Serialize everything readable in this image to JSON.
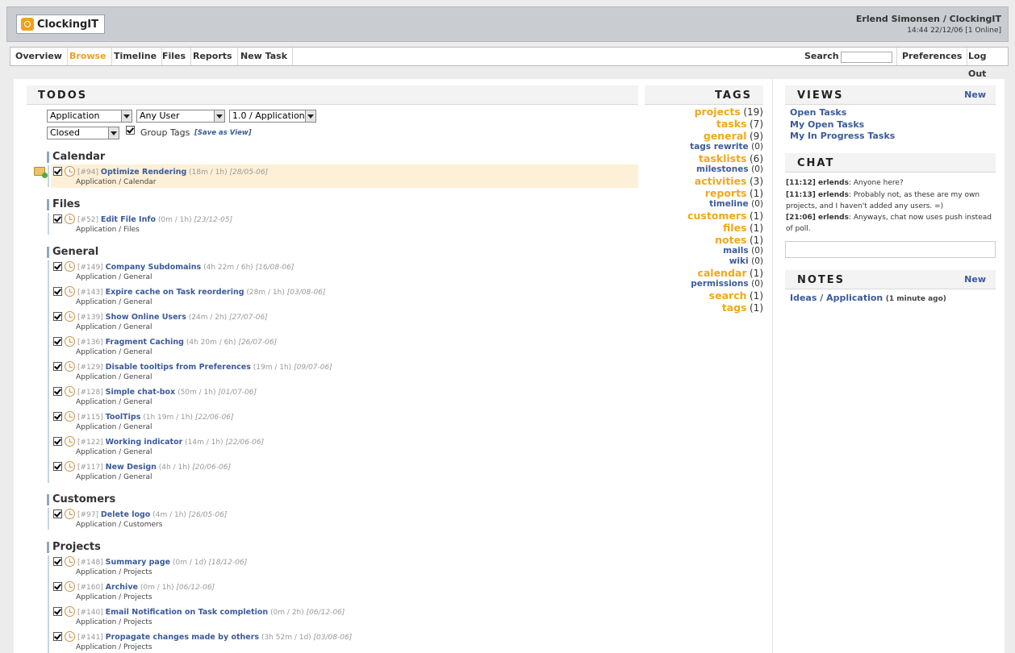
{
  "app": {
    "logo_text": "ClockingIT",
    "user_name": "Erlend Simonsen / ClockingIT",
    "status_line": "14:44 22/12/06 [1 Online]"
  },
  "nav": {
    "items": [
      "Overview",
      "Browse",
      "Timeline",
      "Files",
      "Reports",
      "New Task"
    ],
    "active": "Browse",
    "search_label": "Search",
    "search_value": "",
    "preferences": "Preferences",
    "logout": "Log Out"
  },
  "todos": {
    "title": "TODOS",
    "filters": {
      "project": "Application",
      "user": "Any User",
      "milestone": "1.0 / Application",
      "status": "Closed",
      "group_tags_label": "Group Tags",
      "save_view": "[Save as View]"
    },
    "groups": [
      {
        "name": "Calendar",
        "tasks": [
          {
            "id": "[#94]",
            "name": "Optimize Rendering",
            "time": "(18m / 1h)",
            "date": "[28/05-06]",
            "path": "Application / Calendar",
            "highlight": true
          }
        ]
      },
      {
        "name": "Files",
        "tasks": [
          {
            "id": "[#52]",
            "name": "Edit File Info",
            "time": "(0m / 1h)",
            "date": "[23/12-05]",
            "path": "Application / Files"
          }
        ]
      },
      {
        "name": "General",
        "tasks": [
          {
            "id": "[#149]",
            "name": "Company Subdomains",
            "time": "(4h 22m / 6h)",
            "date": "[16/08-06]",
            "path": "Application / General"
          },
          {
            "id": "[#143]",
            "name": "Expire cache on Task reordering",
            "time": "(28m / 1h)",
            "date": "[03/08-06]",
            "path": "Application / General"
          },
          {
            "id": "[#139]",
            "name": "Show Online Users",
            "time": "(24m / 2h)",
            "date": "[27/07-06]",
            "path": "Application / General"
          },
          {
            "id": "[#136]",
            "name": "Fragment Caching",
            "time": "(4h 20m / 6h)",
            "date": "[26/07-06]",
            "path": "Application / General"
          },
          {
            "id": "[#129]",
            "name": "Disable tooltips from Preferences",
            "time": "(19m / 1h)",
            "date": "[09/07-06]",
            "path": "Application / General"
          },
          {
            "id": "[#128]",
            "name": "Simple chat-box",
            "time": "(50m / 1h)",
            "date": "[01/07-06]",
            "path": "Application / General"
          },
          {
            "id": "[#115]",
            "name": "ToolTips",
            "time": "(1h 19m / 1h)",
            "date": "[22/06-06]",
            "path": "Application / General"
          },
          {
            "id": "[#122]",
            "name": "Working indicator",
            "time": "(14m / 1h)",
            "date": "[22/06-06]",
            "path": "Application / General"
          },
          {
            "id": "[#117]",
            "name": "New Design",
            "time": "(4h / 1h)",
            "date": "[20/06-06]",
            "path": "Application / General"
          }
        ]
      },
      {
        "name": "Customers",
        "tasks": [
          {
            "id": "[#97]",
            "name": "Delete logo",
            "time": "(4m / 1h)",
            "date": "[26/05-06]",
            "path": "Application / Customers"
          }
        ]
      },
      {
        "name": "Projects",
        "tasks": [
          {
            "id": "[#148]",
            "name": "Summary page",
            "time": "(0m / 1d)",
            "date": "[18/12-06]",
            "path": "Application / Projects"
          },
          {
            "id": "[#160]",
            "name": "Archive",
            "time": "(0m / 1h)",
            "date": "[06/12-06]",
            "path": "Application / Projects"
          },
          {
            "id": "[#140]",
            "name": "Email Notification on Task completion",
            "time": "(0m / 2h)",
            "date": "[06/12-06]",
            "path": "Application / Projects"
          },
          {
            "id": "[#141]",
            "name": "Propagate changes made by others",
            "time": "(3h 52m / 1d)",
            "date": "[03/08-06]",
            "path": "Application / Projects"
          }
        ]
      }
    ]
  },
  "tags": {
    "title": "TAGS",
    "items": [
      {
        "name": "projects",
        "count": "(19)",
        "color": "#f0a81a",
        "size": "l"
      },
      {
        "name": "tasks",
        "count": "(7)",
        "color": "#f0a81a",
        "size": "l"
      },
      {
        "name": "general",
        "count": "(9)",
        "color": "#f0a81a",
        "size": "l"
      },
      {
        "name": "tags rewrite",
        "count": "(0)",
        "color": "#3b5a99",
        "size": "s"
      },
      {
        "name": "tasklists",
        "count": "(6)",
        "color": "#f0a81a",
        "size": "l"
      },
      {
        "name": "milestones",
        "count": "(0)",
        "color": "#3b5a99",
        "size": "s"
      },
      {
        "name": "activities",
        "count": "(3)",
        "color": "#f0a81a",
        "size": "l"
      },
      {
        "name": "reports",
        "count": "(1)",
        "color": "#f0a81a",
        "size": "l"
      },
      {
        "name": "timeline",
        "count": "(0)",
        "color": "#3b5a99",
        "size": "s"
      },
      {
        "name": "customers",
        "count": "(1)",
        "color": "#f0a81a",
        "size": "l"
      },
      {
        "name": "files",
        "count": "(1)",
        "color": "#f0a81a",
        "size": "l"
      },
      {
        "name": "notes",
        "count": "(1)",
        "color": "#f0a81a",
        "size": "l"
      },
      {
        "name": "mails",
        "count": "(0)",
        "color": "#3b5a99",
        "size": "s"
      },
      {
        "name": "wiki",
        "count": "(0)",
        "color": "#3b5a99",
        "size": "s"
      },
      {
        "name": "calendar",
        "count": "(1)",
        "color": "#f0a81a",
        "size": "l"
      },
      {
        "name": "permissions",
        "count": "(0)",
        "color": "#3b5a99",
        "size": "s"
      },
      {
        "name": "search",
        "count": "(1)",
        "color": "#f0a81a",
        "size": "l"
      },
      {
        "name": "tags",
        "count": "(1)",
        "color": "#f0a81a",
        "size": "l"
      }
    ]
  },
  "views": {
    "title": "VIEWS",
    "new_label": "New",
    "items": [
      "Open Tasks",
      "My Open Tasks",
      "My In Progress Tasks"
    ]
  },
  "chat": {
    "title": "CHAT",
    "messages": [
      {
        "time": "[11:12] erlends",
        "text": ": Anyone here?"
      },
      {
        "time": "[11:13] erlends",
        "text": ": Probably not, as these are my own projects, and I haven't added any users. =)"
      },
      {
        "time": "[21:06] erlends",
        "text": ": Anyways, chat now uses push instead of poll."
      }
    ],
    "input_value": ""
  },
  "notes": {
    "title": "NOTES",
    "new_label": "New",
    "items": [
      {
        "name": "Ideas / Application",
        "meta": "(1 minute ago)"
      }
    ]
  }
}
